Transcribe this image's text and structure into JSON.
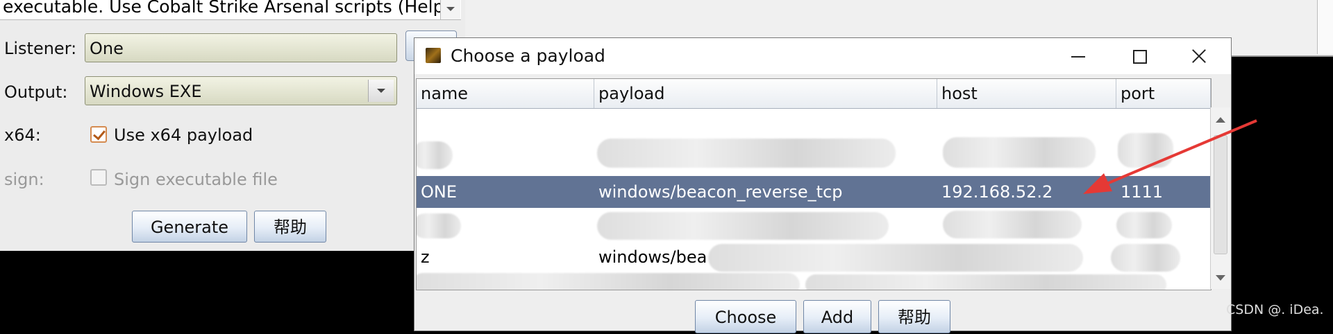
{
  "back_window": {
    "description_text": "executable. Use Cobalt Strike Arsenal scripts (Help",
    "listener_label": "Listener:",
    "listener_value": "One",
    "output_label": "Output:",
    "output_value": "Windows EXE",
    "x64_label": "x64:",
    "x64_checkbox_label": "Use x64 payload",
    "x64_checked": true,
    "sign_label": "sign:",
    "sign_checkbox_label": "Sign executable file",
    "sign_checked": false,
    "generate_button": "Generate",
    "help_button": "帮助"
  },
  "dialog": {
    "title": "Choose a payload",
    "columns": [
      "name",
      "payload",
      "host",
      "port"
    ],
    "rows": [
      {
        "name": "",
        "payload": "",
        "host": "",
        "port": "",
        "redacted": true
      },
      {
        "name": "ONE",
        "payload": "windows/beacon_reverse_tcp",
        "host": "192.168.52.2",
        "port": "1111",
        "selected": true
      },
      {
        "name": "",
        "payload": "",
        "host": "",
        "port": "",
        "redacted": true
      },
      {
        "name": "z",
        "payload": "windows/bea",
        "host": "",
        "port": "",
        "partially_redacted": true
      },
      {
        "name": "",
        "payload": "",
        "host": "",
        "port": "",
        "redacted": true
      }
    ],
    "buttons": {
      "choose": "Choose",
      "add": "Add",
      "help": "帮助"
    }
  },
  "watermark": "CSDN @. iDea.",
  "colors": {
    "selection": "#617394",
    "annotation_arrow": "#e53935"
  }
}
